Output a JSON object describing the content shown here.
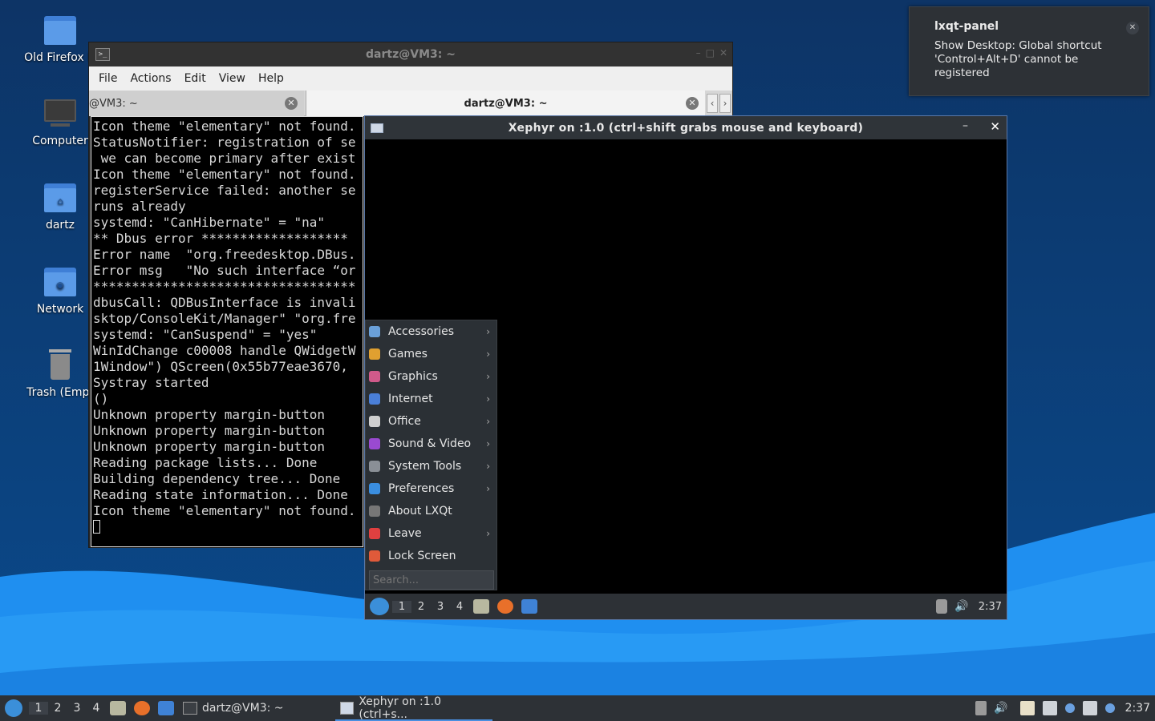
{
  "desktop": {
    "icons": [
      {
        "label": "Old Firefox D"
      },
      {
        "label": "Computer"
      },
      {
        "label": "dartz"
      },
      {
        "label": "Network"
      },
      {
        "label": "Trash (Empt"
      }
    ]
  },
  "terminal": {
    "title": "dartz@VM3: ~",
    "menu": [
      "File",
      "Actions",
      "Edit",
      "View",
      "Help"
    ],
    "tabs": [
      "@VM3: ~",
      "dartz@VM3: ~"
    ],
    "lines": [
      "Icon theme \"elementary\" not found.",
      "StatusNotifier: registration of se",
      " we can become primary after exist",
      "Icon theme \"elementary\" not found.",
      "registerService failed: another se",
      "runs already",
      "systemd: \"CanHibernate\" = \"na\"",
      "** Dbus error *******************",
      "Error name  \"org.freedesktop.DBus.",
      "Error msg   \"No such interface “or",
      "**********************************",
      "dbusCall: QDBusInterface is invali",
      "sktop/ConsoleKit/Manager\" \"org.fre",
      "systemd: \"CanSuspend\" = \"yes\"",
      "WinIdChange c00008 handle QWidgetW",
      "1Window\") QScreen(0x55b77eae3670, ",
      "Systray started",
      "()",
      "Unknown property margin-button",
      "Unknown property margin-button",
      "Unknown property margin-button",
      "Reading package lists... Done",
      "Building dependency tree... Done",
      "Reading state information... Done",
      "Icon theme \"elementary\" not found."
    ]
  },
  "xephyr": {
    "title": "Xephyr on :1.0 (ctrl+shift grabs mouse and keyboard)",
    "menu": [
      {
        "label": "Accessories",
        "submenu": true,
        "color": "#6aa0d8"
      },
      {
        "label": "Games",
        "submenu": true,
        "color": "#e0a030"
      },
      {
        "label": "Graphics",
        "submenu": true,
        "color": "#d05a8a"
      },
      {
        "label": "Internet",
        "submenu": true,
        "color": "#4a7fd8"
      },
      {
        "label": "Office",
        "submenu": true,
        "color": "#cfcfcf"
      },
      {
        "label": "Sound & Video",
        "submenu": true,
        "color": "#9a4ad0"
      },
      {
        "label": "System Tools",
        "submenu": true,
        "color": "#8a8f96"
      },
      {
        "label": "Preferences",
        "submenu": true,
        "color": "#3a8ee0"
      },
      {
        "label": "About LXQt",
        "submenu": false,
        "color": "#777777"
      },
      {
        "label": "Leave",
        "submenu": true,
        "color": "#e04040"
      },
      {
        "label": "Lock Screen",
        "submenu": false,
        "color": "#e05a3a"
      }
    ],
    "search_placeholder": "Search...",
    "workspaces": [
      "1",
      "2",
      "3",
      "4"
    ],
    "clock": "2:37"
  },
  "notification": {
    "title": "lxqt-panel",
    "body": "Show Desktop: Global shortcut 'Control+Alt+D' cannot be registered"
  },
  "taskbar": {
    "workspaces": [
      "1",
      "2",
      "3",
      "4"
    ],
    "tasks": [
      "dartz@VM3: ~",
      "Xephyr on :1.0 (ctrl+s..."
    ],
    "clock": "2:37"
  }
}
